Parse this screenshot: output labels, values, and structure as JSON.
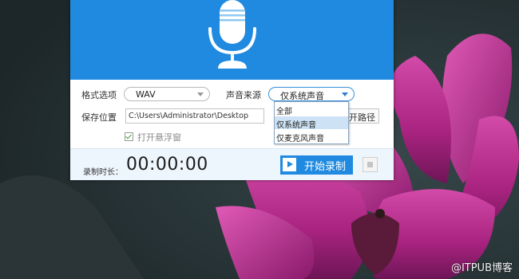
{
  "watermark": "@ITPUB博客",
  "format": {
    "label": "格式选项",
    "selected": "WAV"
  },
  "source": {
    "label": "声音来源",
    "selected": "仅系统声音",
    "options": [
      "全部",
      "仅系统声音",
      "仅麦克风声音"
    ]
  },
  "save": {
    "label": "保存位置",
    "path": "C:\\Users\\Administrator\\Desktop",
    "open_path_button": "开路径"
  },
  "floating_window": {
    "label": "打开悬浮窗",
    "checked": true
  },
  "footer": {
    "duration_label": "录制时长：",
    "duration_value": "00:00:00",
    "start_button": "开始录制"
  },
  "colors": {
    "header": "#1f8ae0",
    "accent": "#1f8ae0"
  },
  "icons": {
    "header": "microphone-icon",
    "start": "play-icon",
    "stop": "stop-icon"
  }
}
